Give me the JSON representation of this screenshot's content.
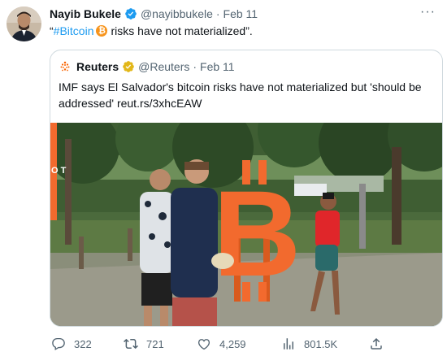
{
  "tweet": {
    "author_name": "Nayib Bukele",
    "author_handle": "@nayibbukele",
    "date": "Feb 11",
    "text_open_quote": "“",
    "hashtag": "#Bitcoin",
    "btc_glyph": "₿",
    "text_rest": " risks have not materialized”.",
    "more_label": "···"
  },
  "quoted": {
    "author_name": "Reuters",
    "author_handle": "@Reuters",
    "date": "Feb 11",
    "text": "IMF says El Salvador's bitcoin risks have not materialized but 'should be addressed' reut.rs/3xhcEAW",
    "photo_sign_letters": "O T",
    "photo_bitcoin_glyph": "B"
  },
  "actions": {
    "replies": "322",
    "retweets": "721",
    "likes": "4,259",
    "views": "801.5K"
  },
  "icons": {
    "verified": "verified-badge-icon",
    "verified_gold": "verified-gold-badge-icon",
    "reply": "reply-icon",
    "retweet": "retweet-icon",
    "like": "heart-icon",
    "views": "views-icon",
    "share": "share-icon"
  },
  "colors": {
    "accent": "#1d9bf0",
    "muted": "#536471",
    "bitcoin_orange": "#f7931a",
    "gold": "#e2b719",
    "sign_orange": "#f26a2e"
  }
}
